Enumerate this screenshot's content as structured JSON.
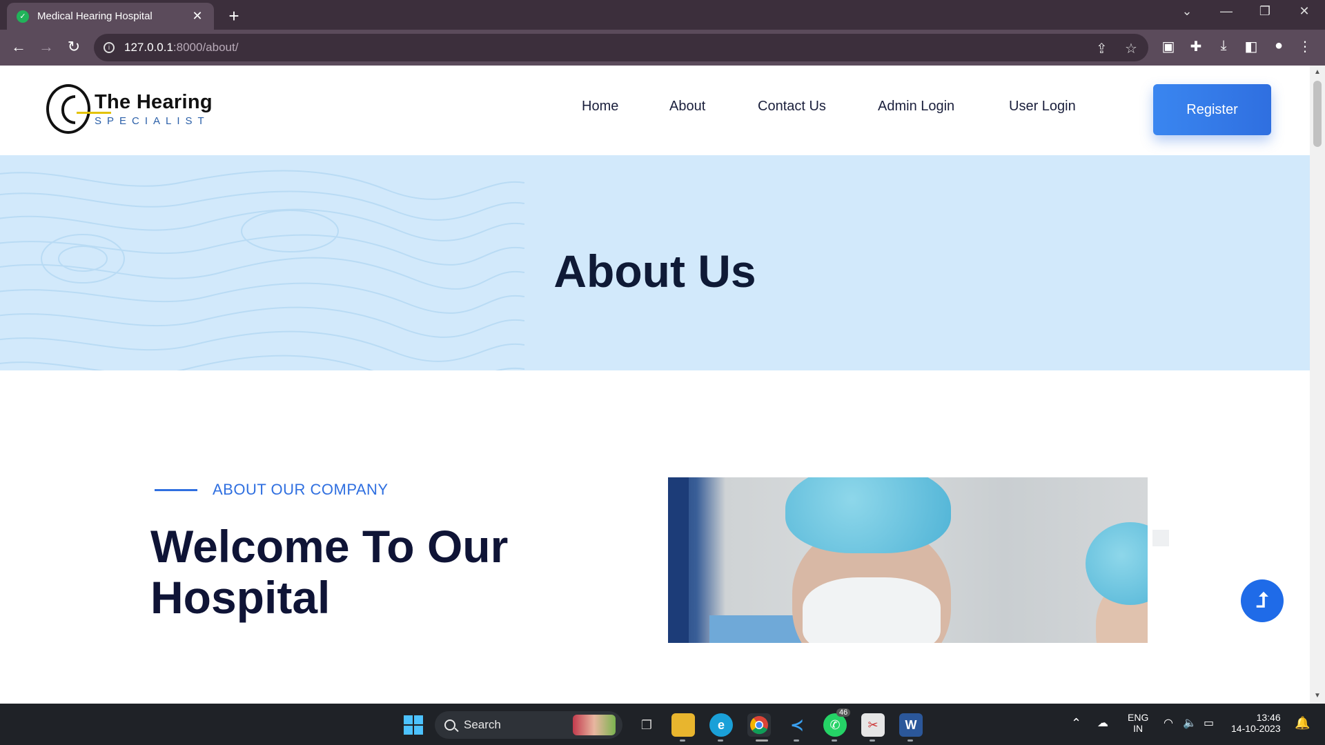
{
  "browser": {
    "tab_title": "Medical Hearing Hospital",
    "new_tab": "+",
    "tab_close": "✕",
    "url_host": "127.0.0.1",
    "url_path": ":8000/about/"
  },
  "site": {
    "logo_line1": "The Hearing",
    "logo_line2": "SPECIALIST",
    "nav": [
      "Home",
      "About",
      "Contact Us",
      "Admin Login",
      "User Login"
    ],
    "register_label": "Register"
  },
  "hero": {
    "title": "About Us"
  },
  "about": {
    "tagline": "ABOUT OUR COMPANY",
    "heading": "Welcome To Our Hospital"
  },
  "taskbar": {
    "search_label": "Search",
    "whatsapp_badge": "46",
    "lang_top": "ENG",
    "lang_bottom": "IN",
    "time": "13:46",
    "date": "14-10-2023"
  },
  "colors": {
    "accent": "#2f6fe0",
    "hero_bg": "#d2e9fb",
    "chrome_dark": "#3c2f3c",
    "chrome_tab": "#5b4b5b"
  }
}
